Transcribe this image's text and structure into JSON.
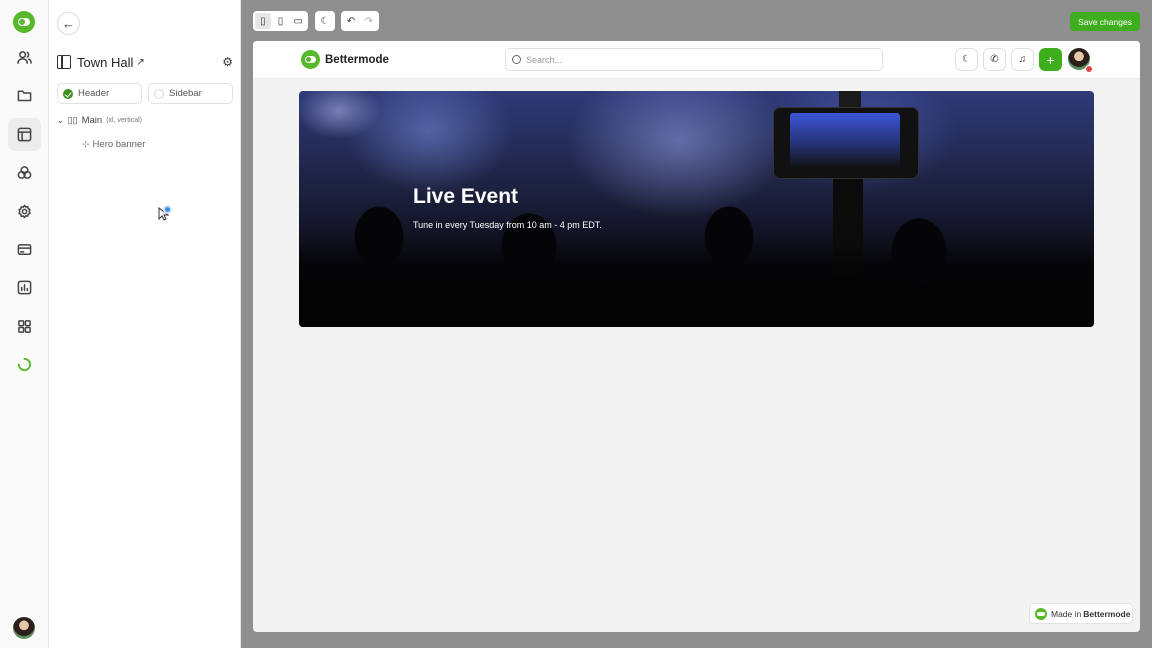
{
  "panel": {
    "title": "Town Hall",
    "tabs": [
      {
        "label": "Header",
        "selected": true
      },
      {
        "label": "Sidebar",
        "selected": false
      }
    ],
    "tree": {
      "main_label": "Main",
      "main_hint": "(xl, vertical)",
      "child_label": "Hero banner"
    }
  },
  "toolbar": {
    "save_label": "Save changes"
  },
  "site": {
    "brand": "Bettermode",
    "search_placeholder": "Search..."
  },
  "hero": {
    "title": "Live Event",
    "subtitle": "Tune in every Tuesday from 10 am - 4 pm EDT."
  },
  "badge": {
    "prefix": "Made in",
    "brand": "Bettermode"
  },
  "colors": {
    "accent": "#3fae1e",
    "brand_green": "#57b82c",
    "canvas": "#8f8f8f"
  },
  "icons": [
    "user-icon",
    "folder-icon",
    "layout-icon",
    "palette-icon",
    "gear-icon",
    "credit-card-icon",
    "chart-icon",
    "apps-icon",
    "loading-icon",
    "moon-icon",
    "chat-icon",
    "bell-icon",
    "plus-icon",
    "undo-icon",
    "redo-icon",
    "mobile-icon",
    "tablet-icon",
    "desktop-icon"
  ]
}
